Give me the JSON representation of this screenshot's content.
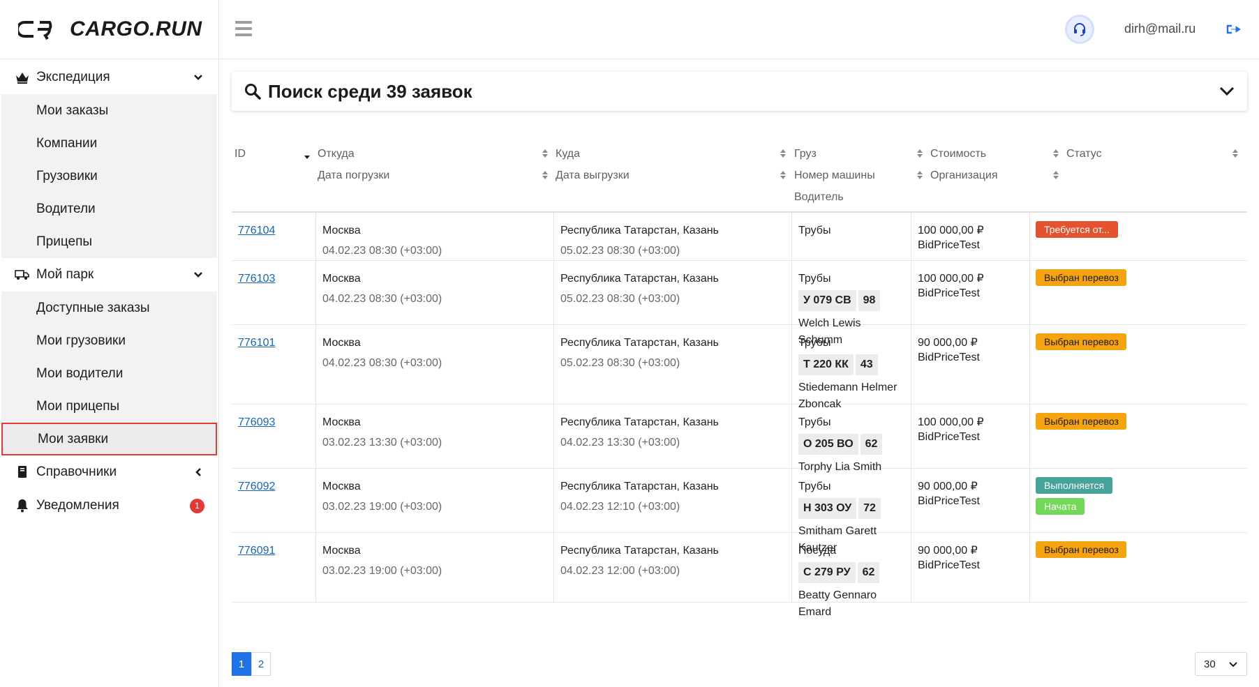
{
  "brand": {
    "name": "CARGO.RUN"
  },
  "sidebar": {
    "groups": [
      {
        "label": "Экспедиция",
        "items": [
          "Мои заказы",
          "Компании",
          "Грузовики",
          "Водители",
          "Прицепы"
        ]
      },
      {
        "label": "Мой парк",
        "items": [
          "Доступные заказы",
          "Мои грузовики",
          "Мои водители",
          "Мои прицепы",
          "Мои заявки"
        ]
      },
      {
        "label": "Справочники"
      },
      {
        "label": "Уведомления",
        "badge": "1"
      }
    ],
    "active_item": "Мои заявки"
  },
  "header": {
    "user_email": "dirh@mail.ru"
  },
  "search": {
    "title": "Поиск среди 39 заявок"
  },
  "table": {
    "columns": [
      {
        "label": "ID"
      },
      {
        "label": "Откуда",
        "sub": "Дата погрузки"
      },
      {
        "label": "Куда",
        "sub": "Дата выгрузки"
      },
      {
        "label": "Груз",
        "sub": "Номер машины",
        "sub2": "Водитель"
      },
      {
        "label": "Стоимость",
        "sub": "Организация"
      },
      {
        "label": "Статус"
      }
    ],
    "rows": [
      {
        "id": "776104",
        "from": "Москва",
        "load_date": "04.02.23 08:30 (+03:00)",
        "to": "Республика Татарстан, Казань",
        "unload_date": "05.02.23 08:30 (+03:00)",
        "cargo": "Трубы",
        "plate": "",
        "region": "",
        "driver": "",
        "price": "100 000,00 ₽",
        "org": "BidPriceTest",
        "statuses": [
          {
            "text": "Требуется от...",
            "color": "#e5532e"
          }
        ]
      },
      {
        "id": "776103",
        "from": "Москва",
        "load_date": "04.02.23 08:30 (+03:00)",
        "to": "Республика Татарстан, Казань",
        "unload_date": "05.02.23 08:30 (+03:00)",
        "cargo": "Трубы",
        "plate": "У 079 СВ",
        "region": "98",
        "driver": "Welch Lewis Schumm",
        "price": "100 000,00 ₽",
        "org": "BidPriceTest",
        "statuses": [
          {
            "text": "Выбран перевоз",
            "color": "#f5a40f"
          }
        ]
      },
      {
        "id": "776101",
        "from": "Москва",
        "load_date": "04.02.23 08:30 (+03:00)",
        "to": "Республика Татарстан, Казань",
        "unload_date": "05.02.23 08:30 (+03:00)",
        "cargo": "Трубы",
        "plate": "Т 220 КК",
        "region": "43",
        "driver": "Stiedemann Helmer Zboncak",
        "price": "90 000,00 ₽",
        "org": "BidPriceTest",
        "statuses": [
          {
            "text": "Выбран перевоз",
            "color": "#f5a40f"
          }
        ]
      },
      {
        "id": "776093",
        "from": "Москва",
        "load_date": "03.02.23 13:30 (+03:00)",
        "to": "Республика Татарстан, Казань",
        "unload_date": "04.02.23 13:30 (+03:00)",
        "cargo": "Трубы",
        "plate": "О 205 ВО",
        "region": "62",
        "driver": "Torphy Lia Smith",
        "price": "100 000,00 ₽",
        "org": "BidPriceTest",
        "statuses": [
          {
            "text": "Выбран перевоз",
            "color": "#f5a40f"
          }
        ]
      },
      {
        "id": "776092",
        "from": "Москва",
        "load_date": "03.02.23 19:00 (+03:00)",
        "to": "Республика Татарстан, Казань",
        "unload_date": "04.02.23 12:10 (+03:00)",
        "cargo": "Трубы",
        "plate": "Н 303 ОУ",
        "region": "72",
        "driver": "Smitham Garett Kautzer",
        "price": "90 000,00 ₽",
        "org": "BidPriceTest",
        "statuses": [
          {
            "text": "Выполняется",
            "color": "#46a39a"
          },
          {
            "text": "Начата",
            "color": "#71d957"
          }
        ]
      },
      {
        "id": "776091",
        "from": "Москва",
        "load_date": "03.02.23 19:00 (+03:00)",
        "to": "Республика Татарстан, Казань",
        "unload_date": "04.02.23 12:00 (+03:00)",
        "cargo": "Посуда",
        "plate": "С 279 РУ",
        "region": "62",
        "driver": "Beatty Gennaro Emard",
        "price": "90 000,00 ₽",
        "org": "BidPriceTest",
        "statuses": [
          {
            "text": "Выбран перевоз",
            "color": "#f5a40f"
          }
        ]
      }
    ]
  },
  "pagination": {
    "pages": [
      "1",
      "2"
    ],
    "current": "1",
    "per_page": "30"
  },
  "colors": {
    "accent": "#1e73e8",
    "link": "#1565c0",
    "active_border": "#e53935"
  },
  "icons": {
    "support": "headset-icon",
    "logout": "logout-icon",
    "search": "search-icon"
  }
}
